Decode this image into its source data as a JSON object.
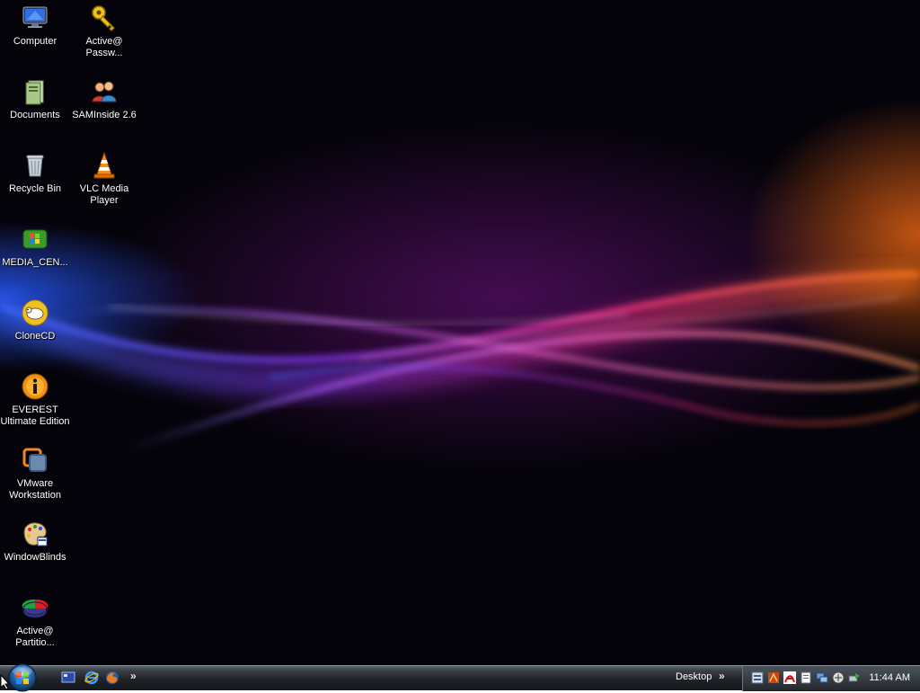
{
  "desktop_icons": [
    {
      "id": "computer",
      "label": "Computer",
      "icon": "monitor-icon"
    },
    {
      "id": "active-password",
      "label": "Active@\nPassw...",
      "icon": "key-icon"
    },
    {
      "id": "documents",
      "label": "Documents",
      "icon": "documents-folder-icon"
    },
    {
      "id": "saminside",
      "label": "SAMInside 2.6",
      "icon": "users-icon"
    },
    {
      "id": "recycle-bin",
      "label": "Recycle Bin",
      "icon": "recycle-bin-icon"
    },
    {
      "id": "vlc",
      "label": "VLC Media\nPlayer",
      "icon": "traffic-cone-icon"
    },
    {
      "id": "media-center",
      "label": "MEDIA_CEN...",
      "icon": "media-center-icon"
    },
    {
      "id": "clonecd",
      "label": "CloneCD",
      "icon": "sheep-icon"
    },
    {
      "id": "everest",
      "label": "EVEREST\nUltimate Edition",
      "icon": "info-icon"
    },
    {
      "id": "vmware",
      "label": "VMware\nWorkstation",
      "icon": "vmware-icon"
    },
    {
      "id": "windowblinds",
      "label": "WindowBlinds",
      "icon": "palette-icon"
    },
    {
      "id": "active-partition",
      "label": "Active@\nPartitio...",
      "icon": "pie-disk-icon"
    }
  ],
  "taskbar": {
    "quick_launch": [
      "show-desktop-icon",
      "internet-explorer-icon",
      "firefox-icon"
    ],
    "quick_launch_more": "»",
    "desktop_toolbar_label": "Desktop",
    "desktop_toolbar_more": "»",
    "tray_icons": [
      "app-icon",
      "antivirus-icon",
      "acrobat-icon",
      "document-icon",
      "network-icon",
      "security-icon",
      "safely-remove-icon"
    ],
    "clock": "11:44 AM"
  },
  "colors": {
    "accent_blue": "#2a5cff",
    "accent_magenta": "#d0207a",
    "accent_orange": "#ff6a10",
    "background": "#05030a"
  }
}
